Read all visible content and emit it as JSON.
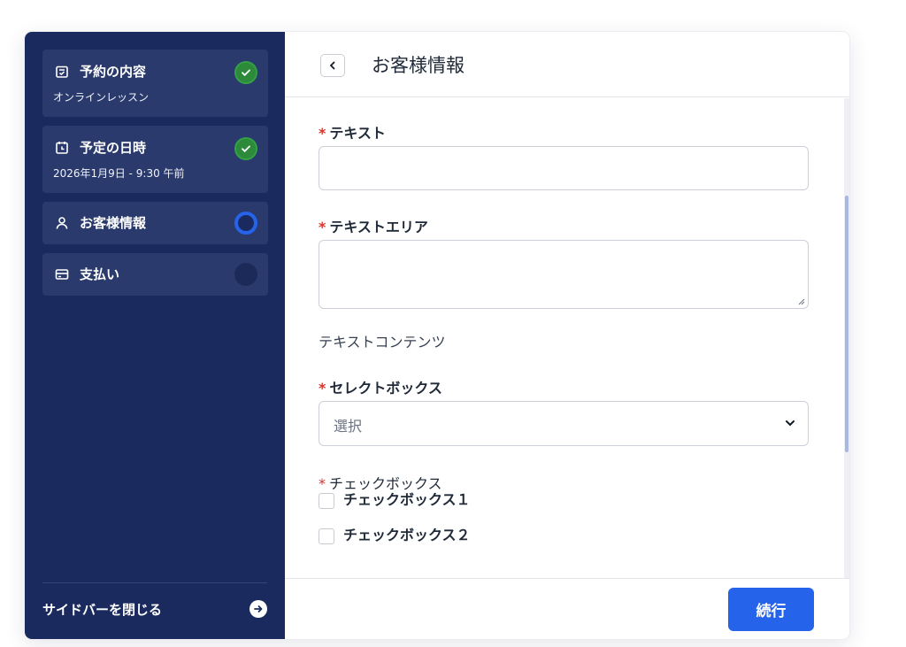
{
  "sidebar": {
    "steps": [
      {
        "title": "予約の内容",
        "subtitle": "オンラインレッスン",
        "icon": "calendar-check-icon",
        "status": "done"
      },
      {
        "title": "予定の日時",
        "subtitle": "2026年1月9日 - 9:30 午前",
        "icon": "clock-calendar-icon",
        "status": "done"
      },
      {
        "title": "お客様情報",
        "subtitle": "",
        "icon": "user-icon",
        "status": "active"
      },
      {
        "title": "支払い",
        "subtitle": "",
        "icon": "credit-card-icon",
        "status": "pending"
      }
    ],
    "close_label": "サイドバーを閉じる",
    "close_icon": "arrow-right-circle-icon"
  },
  "header": {
    "back_icon": "chevron-left-icon",
    "title": "お客様情報"
  },
  "form": {
    "required_mark": "*",
    "text_field": {
      "label": "テキスト",
      "value": ""
    },
    "textarea_field": {
      "label": "テキストエリア",
      "value": ""
    },
    "content_text": "テキストコンテンツ",
    "select_field": {
      "label": "セレクトボックス",
      "selected": "選択"
    },
    "checkbox_group": {
      "label": "チェックボックス",
      "options": [
        "チェックボックス１",
        "チェックボックス２"
      ]
    }
  },
  "footer": {
    "continue_label": "続行"
  },
  "colors": {
    "sidebar_bg": "#1b2a5e",
    "step_bg": "#2a3a6c",
    "done": "#2c8a3a",
    "active": "#2563eb",
    "required": "#d9342b",
    "primary_button": "#2563eb"
  }
}
